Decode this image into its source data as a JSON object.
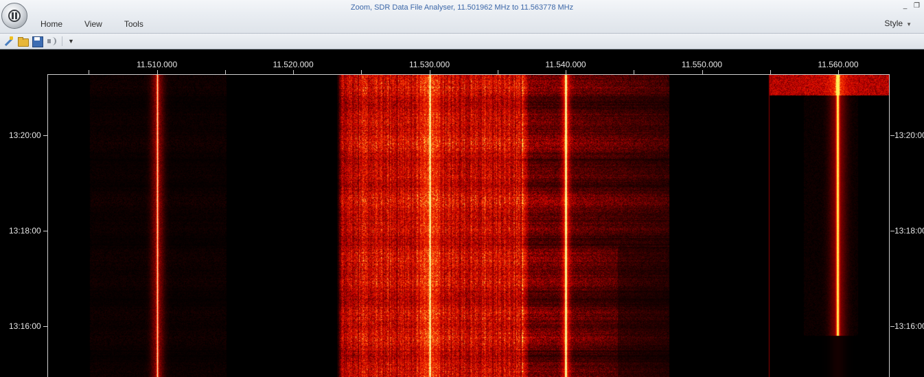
{
  "window": {
    "title": "Zoom,  SDR Data File Analyser, 11.501962 MHz to 11.563778 MHz",
    "controls": [
      "minimize-icon",
      "restore-icon"
    ]
  },
  "menu": {
    "items": [
      {
        "name": "home",
        "label": "Home"
      },
      {
        "name": "view",
        "label": "View"
      },
      {
        "name": "tools",
        "label": "Tools"
      }
    ],
    "style_label": "Style"
  },
  "toolbar": {
    "icons": [
      "wand-icon",
      "open-folder-icon",
      "save-icon",
      "speaker-icon"
    ],
    "dropdown_icon": "customize-dropdown-icon"
  },
  "waterfall": {
    "freq_range_mhz": [
      11.501962,
      11.563778
    ],
    "freq_ticks": [
      {
        "value": 11.51,
        "label": "11.510.000"
      },
      {
        "value": 11.52,
        "label": "11.520.000"
      },
      {
        "value": 11.53,
        "label": "11.530.000"
      },
      {
        "value": 11.54,
        "label": "11.540.000"
      },
      {
        "value": 11.55,
        "label": "11.550.000"
      },
      {
        "value": 11.56,
        "label": "11.560.000"
      }
    ],
    "time_labels": [
      "13:20:00",
      "13:18:00",
      "13:16:00"
    ],
    "colors": {
      "background": "#000000",
      "signal_low": "#5a0000",
      "signal_mid": "#ff2a00",
      "signal_high": "#ffe070"
    }
  }
}
